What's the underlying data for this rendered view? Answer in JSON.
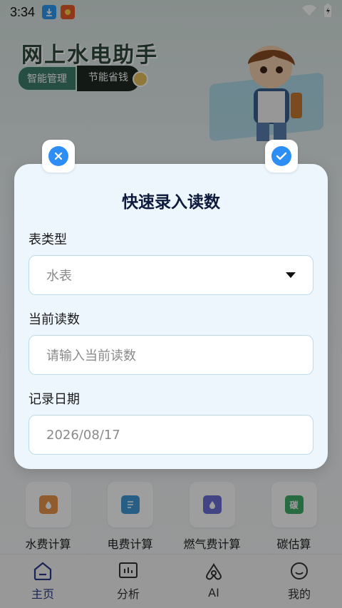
{
  "status_bar": {
    "time": "3:34"
  },
  "banner": {
    "title": "网上水电助手",
    "tag1": "智能管理",
    "tag2": "节能省钱"
  },
  "features": [
    {
      "label": "水费计算",
      "icon": "water-bill-icon",
      "color": "#e8934a"
    },
    {
      "label": "电费计算",
      "icon": "electric-bill-icon",
      "color": "#3f98d8"
    },
    {
      "label": "燃气费计算",
      "icon": "gas-bill-icon",
      "color": "#6c6fd6"
    },
    {
      "label": "碳估算",
      "icon": "carbon-icon",
      "color": "#3fae6a",
      "glyph": "碳"
    }
  ],
  "tabs": [
    {
      "label": "主页",
      "icon": "home-icon"
    },
    {
      "label": "分析",
      "icon": "chart-icon"
    },
    {
      "label": "AI",
      "icon": "ai-icon"
    },
    {
      "label": "我的",
      "icon": "profile-icon"
    }
  ],
  "dialog": {
    "title": "快速录入读数",
    "meter_type_label": "表类型",
    "meter_type_value": "水表",
    "reading_label": "当前读数",
    "reading_placeholder": "请输入当前读数",
    "date_label": "记录日期",
    "date_value": "2026/08/17"
  },
  "colors": {
    "accent": "#2d8ff5",
    "title": "#0e1a3d",
    "field_border": "#b9daf0"
  }
}
